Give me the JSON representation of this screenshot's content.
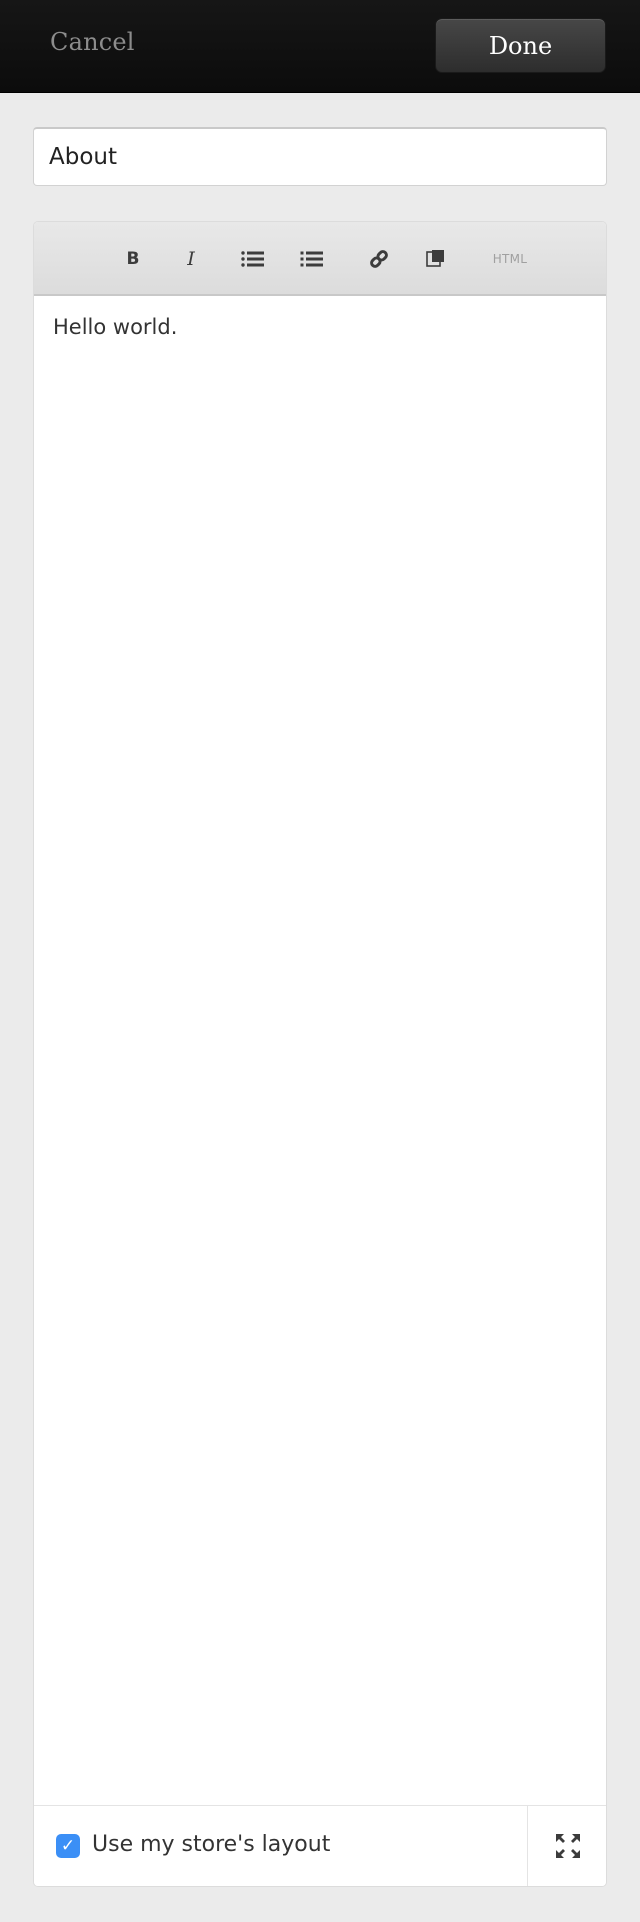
{
  "topbar": {
    "cancel_label": "Cancel",
    "done_label": "Done"
  },
  "title_field": {
    "value": "About"
  },
  "toolbar": {
    "bold_label": "B",
    "italic_label": "I",
    "html_label": "HTML",
    "icons": [
      "bold-icon",
      "italic-icon",
      "bulleted-list-icon",
      "numbered-list-icon",
      "link-icon",
      "image-icon",
      "html-source"
    ]
  },
  "editor": {
    "content": "Hello world."
  },
  "footer": {
    "layout_checkbox_checked": true,
    "layout_checkbox_label": "Use my store's layout",
    "expand_icon": "fullscreen-expand-icon"
  },
  "colors": {
    "topbar_bg": "#111111",
    "page_bg": "#ebebeb",
    "checkbox_accent": "#3b8ff6"
  }
}
